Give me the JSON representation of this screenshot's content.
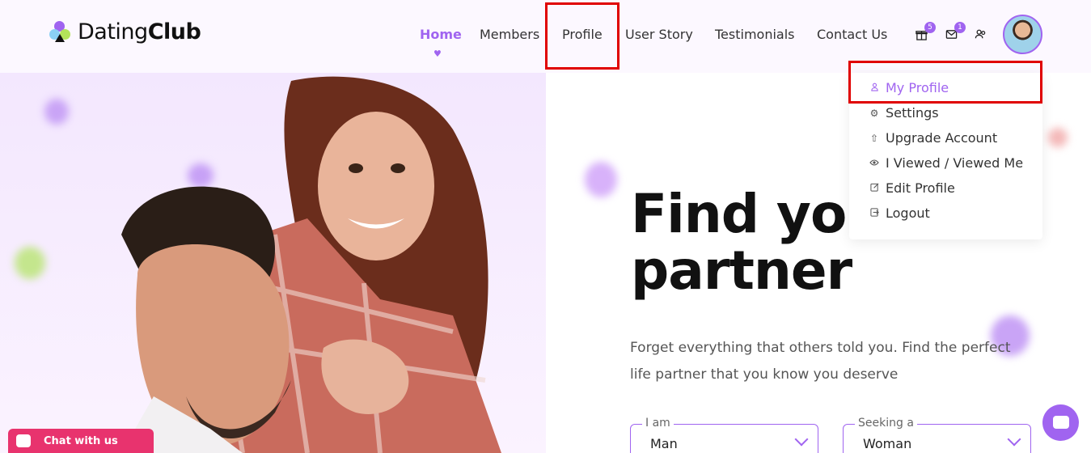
{
  "brand": {
    "light": "Dating",
    "bold": "Club"
  },
  "nav": {
    "items": [
      {
        "label": "Home",
        "active": true
      },
      {
        "label": "Members"
      },
      {
        "label": "Profile"
      },
      {
        "label": "User Story"
      },
      {
        "label": "Testimonials"
      },
      {
        "label": "Contact Us"
      }
    ]
  },
  "header_icons": {
    "gift": {
      "icon": "gift-icon",
      "count": "5"
    },
    "mail": {
      "icon": "mail-icon",
      "count": "1"
    },
    "friends": {
      "icon": "users-icon"
    }
  },
  "profile_menu": {
    "items": [
      {
        "label": "My Profile",
        "icon": "user-icon"
      },
      {
        "label": "Settings",
        "icon": "gear-icon"
      },
      {
        "label": "Upgrade Account",
        "icon": "upload-icon"
      },
      {
        "label": "I Viewed / Viewed Me",
        "icon": "eye-icon"
      },
      {
        "label": "Edit Profile",
        "icon": "edit-icon"
      },
      {
        "label": "Logout",
        "icon": "logout-icon"
      }
    ]
  },
  "hero": {
    "title_line1": "Find you",
    "title_line2": "partner",
    "description": "Forget everything that others told you. Find the perfect life partner that you know you deserve"
  },
  "search": {
    "i_am": {
      "label": "I am",
      "value": "Man"
    },
    "seeking": {
      "label": "Seeking a",
      "value": "Woman"
    }
  },
  "chat": {
    "label": "Chat with us"
  },
  "colors": {
    "accent": "#a064f0",
    "highlight": "#e00000",
    "chat": "#e8336e"
  }
}
